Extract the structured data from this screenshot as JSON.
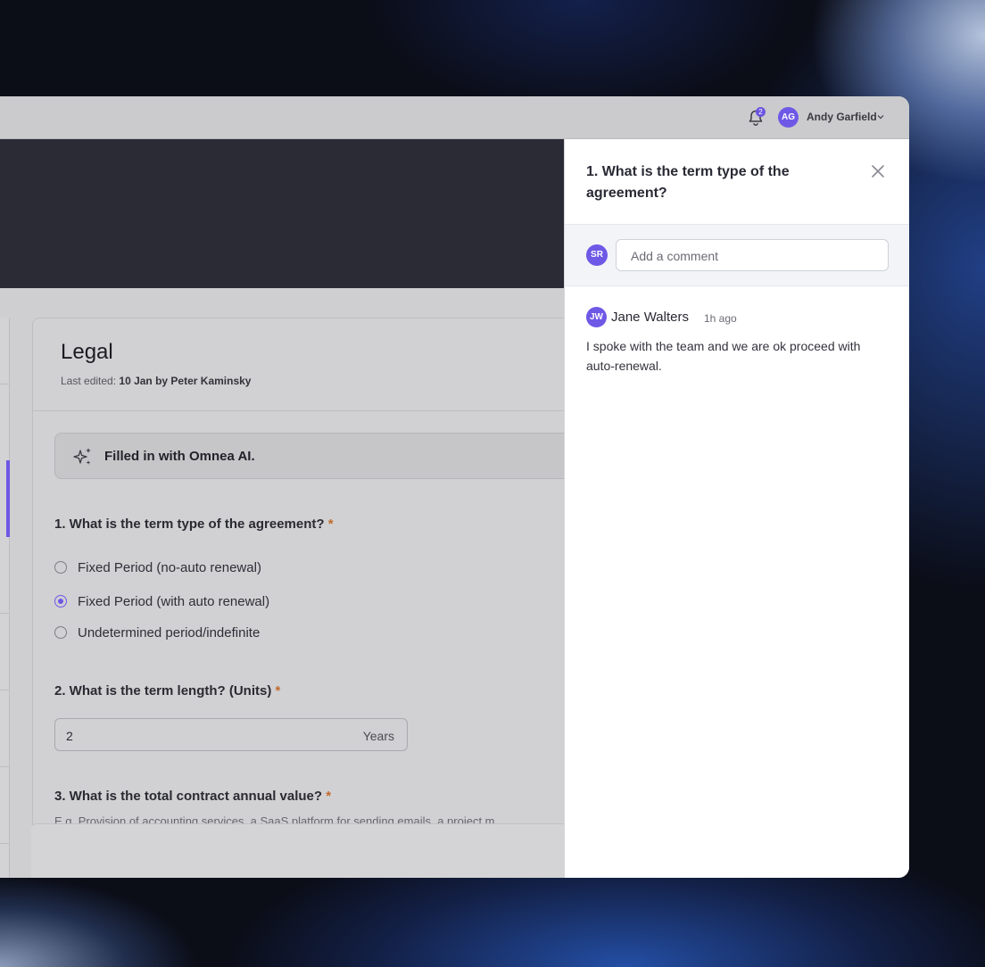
{
  "header": {
    "notification_count": "2",
    "user_initials": "AG",
    "user_name": "Andy Garfield"
  },
  "form": {
    "section_title": "Legal",
    "last_edited_label": "Last edited:",
    "last_edited_value": "10 Jan by Peter Kaminsky",
    "ai_banner": "Filled in with Omnea AI.",
    "q1": {
      "label": "1.  What is the term type of the agreement?",
      "required": "*",
      "options": [
        {
          "label": "Fixed Period (no-auto renewal)",
          "checked": false
        },
        {
          "label": "Fixed Period (with auto renewal)",
          "checked": true
        },
        {
          "label": "Undetermined period/indefinite",
          "checked": false
        }
      ]
    },
    "q2": {
      "label": "2. What is the term length? (Units)",
      "required": "*",
      "value": "2",
      "unit": "Years"
    },
    "q3": {
      "label": "3. What is the total contract annual value?",
      "required": "*",
      "hint": "E.g. Provision of accounting services, a SaaS platform for sending emails, a project m"
    }
  },
  "comments_panel": {
    "title": "1.  What is the term type of the agreement?",
    "current_user_initials": "SR",
    "comment_placeholder": "Add a comment",
    "comments": [
      {
        "initials": "JW",
        "author": "Jane Walters",
        "time": "1h ago",
        "text": "I spoke with the team and we are ok proceed with auto-renewal."
      }
    ]
  },
  "colors": {
    "accent": "#6e58e6",
    "required": "#c26a2c",
    "hero": "#2a2b35"
  }
}
